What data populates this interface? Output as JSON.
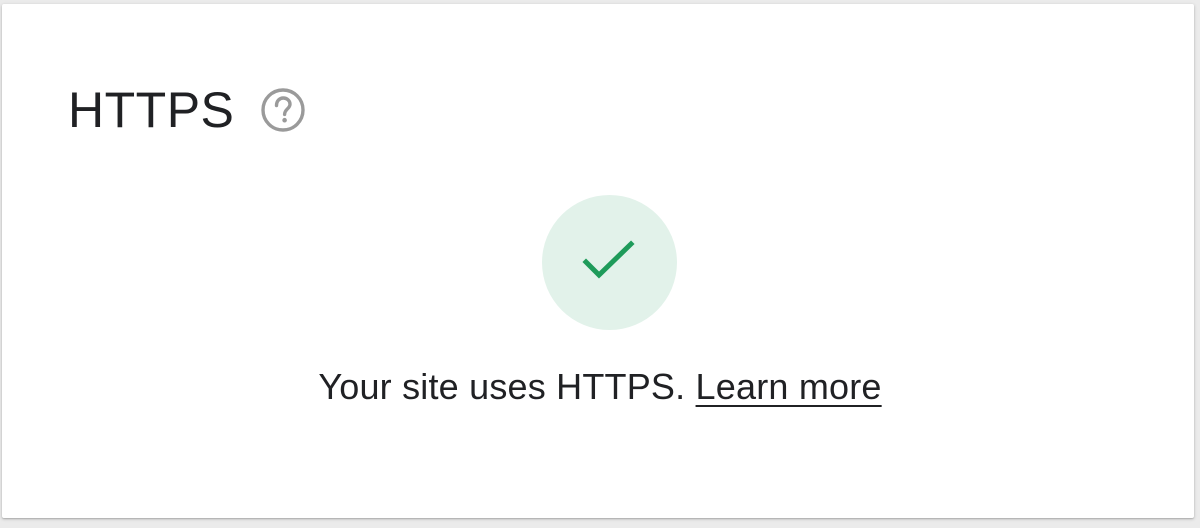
{
  "card": {
    "title": "HTTPS",
    "help_icon": "help-circle-outline-icon",
    "status_icon": "checkmark-icon",
    "message": "Your site uses HTTPS.",
    "link_label": "Learn more"
  },
  "colors": {
    "check": "#1e9b5a",
    "check_background": "#e2f2ea",
    "help_icon": "#9a9a9a",
    "text": "#202124"
  }
}
